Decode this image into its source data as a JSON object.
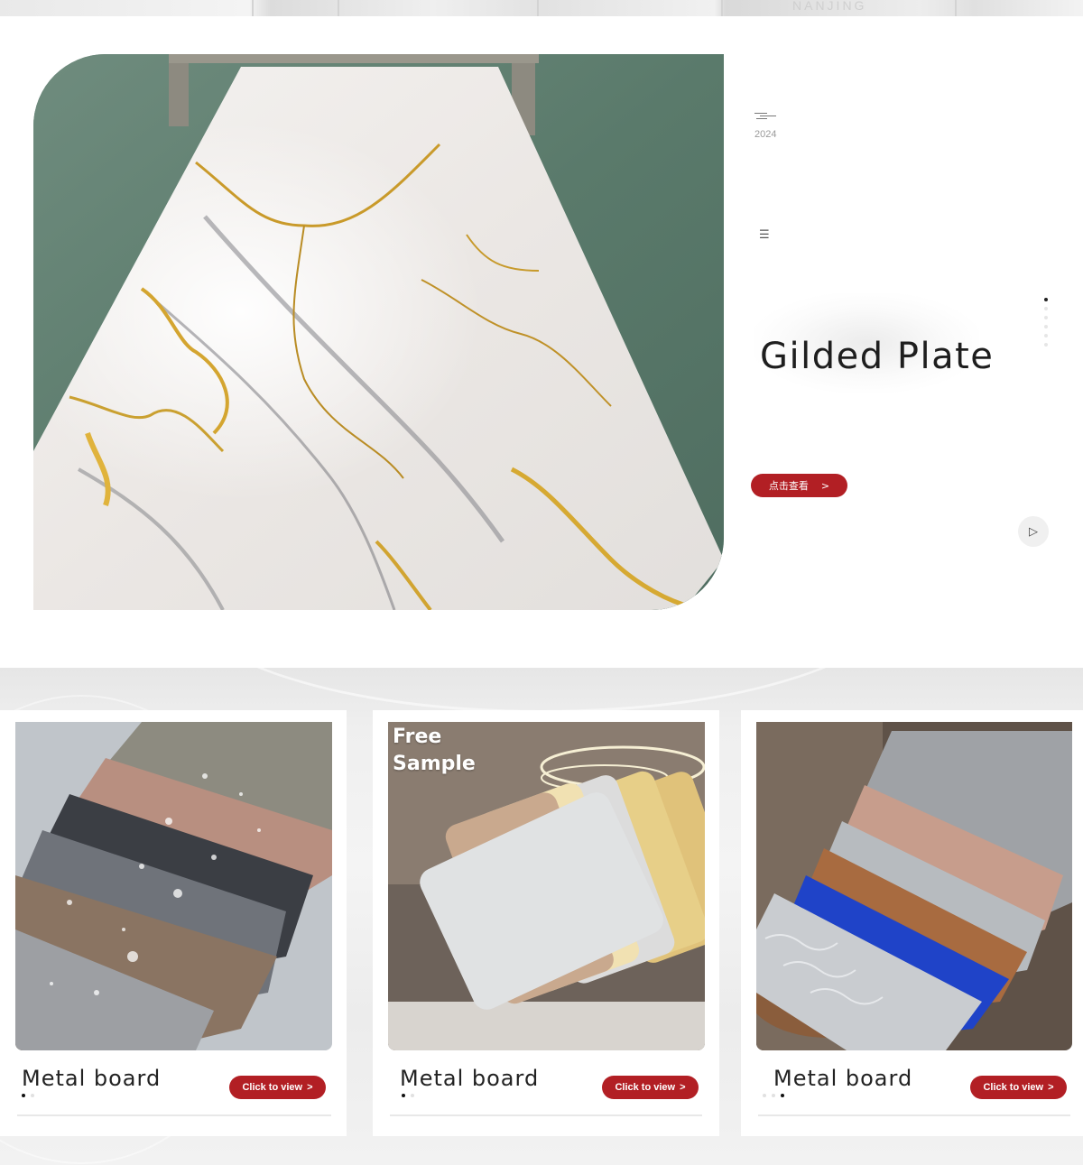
{
  "top_strip": {
    "brand_word": "NANJING"
  },
  "hero": {
    "year": "2024",
    "menu_icon": "menu-icon",
    "title": "Gilded Plate",
    "cta_label": "点击查看",
    "cta_arrow": ">",
    "play_icon": "play-icon",
    "slides": {
      "count": 6,
      "active_index": 0
    }
  },
  "cards": [
    {
      "title": "Metal board",
      "cta_label": "Click to view",
      "cta_arrow": ">",
      "image": "metal-board-samples-with-water-drops",
      "dots": {
        "count": 2,
        "active_index": 0
      }
    },
    {
      "title": "Metal board",
      "cta_label": "Click to view",
      "cta_arrow": ">",
      "image": "free-sample-fan-of-metal-boards",
      "badge_line1": "Free",
      "badge_line2": "Sample",
      "dots": {
        "count": 2,
        "active_index": 0
      }
    },
    {
      "title": "Metal board",
      "cta_label": "Click to view",
      "cta_arrow": ">",
      "image": "stacked-colored-metal-boards",
      "dots": {
        "count": 3,
        "active_index": 2
      }
    }
  ],
  "colors": {
    "accent_red": "#b21f24",
    "title_text": "#1e1e1e"
  }
}
